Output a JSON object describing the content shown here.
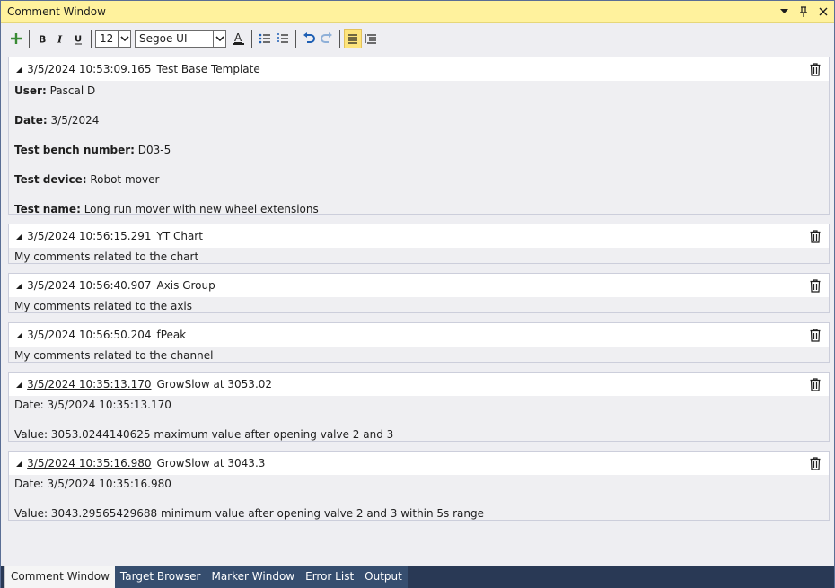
{
  "window": {
    "title": "Comment Window"
  },
  "toolbar": {
    "font_size": "12",
    "font_family": "Segoe UI"
  },
  "comments": [
    {
      "timestamp": "3/5/2024 10:53:09.165",
      "subject": "Test Base Template",
      "linked": false,
      "lines": [
        {
          "label": "User:",
          "value": " Pascal D"
        },
        {
          "label": "Date:",
          "value": " 3/5/2024"
        },
        {
          "label": "Test bench number:",
          "value": " D03-5"
        },
        {
          "label": "Test device:",
          "value": " Robot mover"
        },
        {
          "label": "Test name:",
          "value": " Long run mover with new wheel extensions"
        }
      ]
    },
    {
      "timestamp": "3/5/2024 10:56:15.291",
      "subject": "YT Chart",
      "linked": false,
      "text": "My comments related to the chart"
    },
    {
      "timestamp": "3/5/2024 10:56:40.907",
      "subject": "Axis Group",
      "linked": false,
      "text": "My comments related to the axis"
    },
    {
      "timestamp": "3/5/2024 10:56:50.204",
      "subject": "fPeak",
      "linked": false,
      "text": "My comments related to the channel"
    },
    {
      "timestamp": "3/5/2024 10:35:13.170",
      "subject": "GrowSlow at 3053.02",
      "linked": true,
      "date_line": "Date: 3/5/2024 10:35:13.170",
      "value_line": "Value: 3053.0244140625 maximum value after opening valve 2 and 3"
    },
    {
      "timestamp": "3/5/2024 10:35:16.980",
      "subject": "GrowSlow at 3043.3",
      "linked": true,
      "date_line": "Date: 3/5/2024 10:35:16.980",
      "value_line": "Value: 3043.29565429688 minimum value after opening valve 2 and 3 within 5s range"
    }
  ],
  "tabs": [
    {
      "label": "Comment Window",
      "active": true
    },
    {
      "label": "Target Browser",
      "active": false
    },
    {
      "label": "Marker Window",
      "active": false
    },
    {
      "label": "Error List",
      "active": false
    },
    {
      "label": "Output",
      "active": false
    }
  ],
  "colors": {
    "title_bar": "#fff29d",
    "tab_strip": "#293955",
    "add_icon": "#388a34",
    "undo_icon": "#1e5fb4"
  }
}
